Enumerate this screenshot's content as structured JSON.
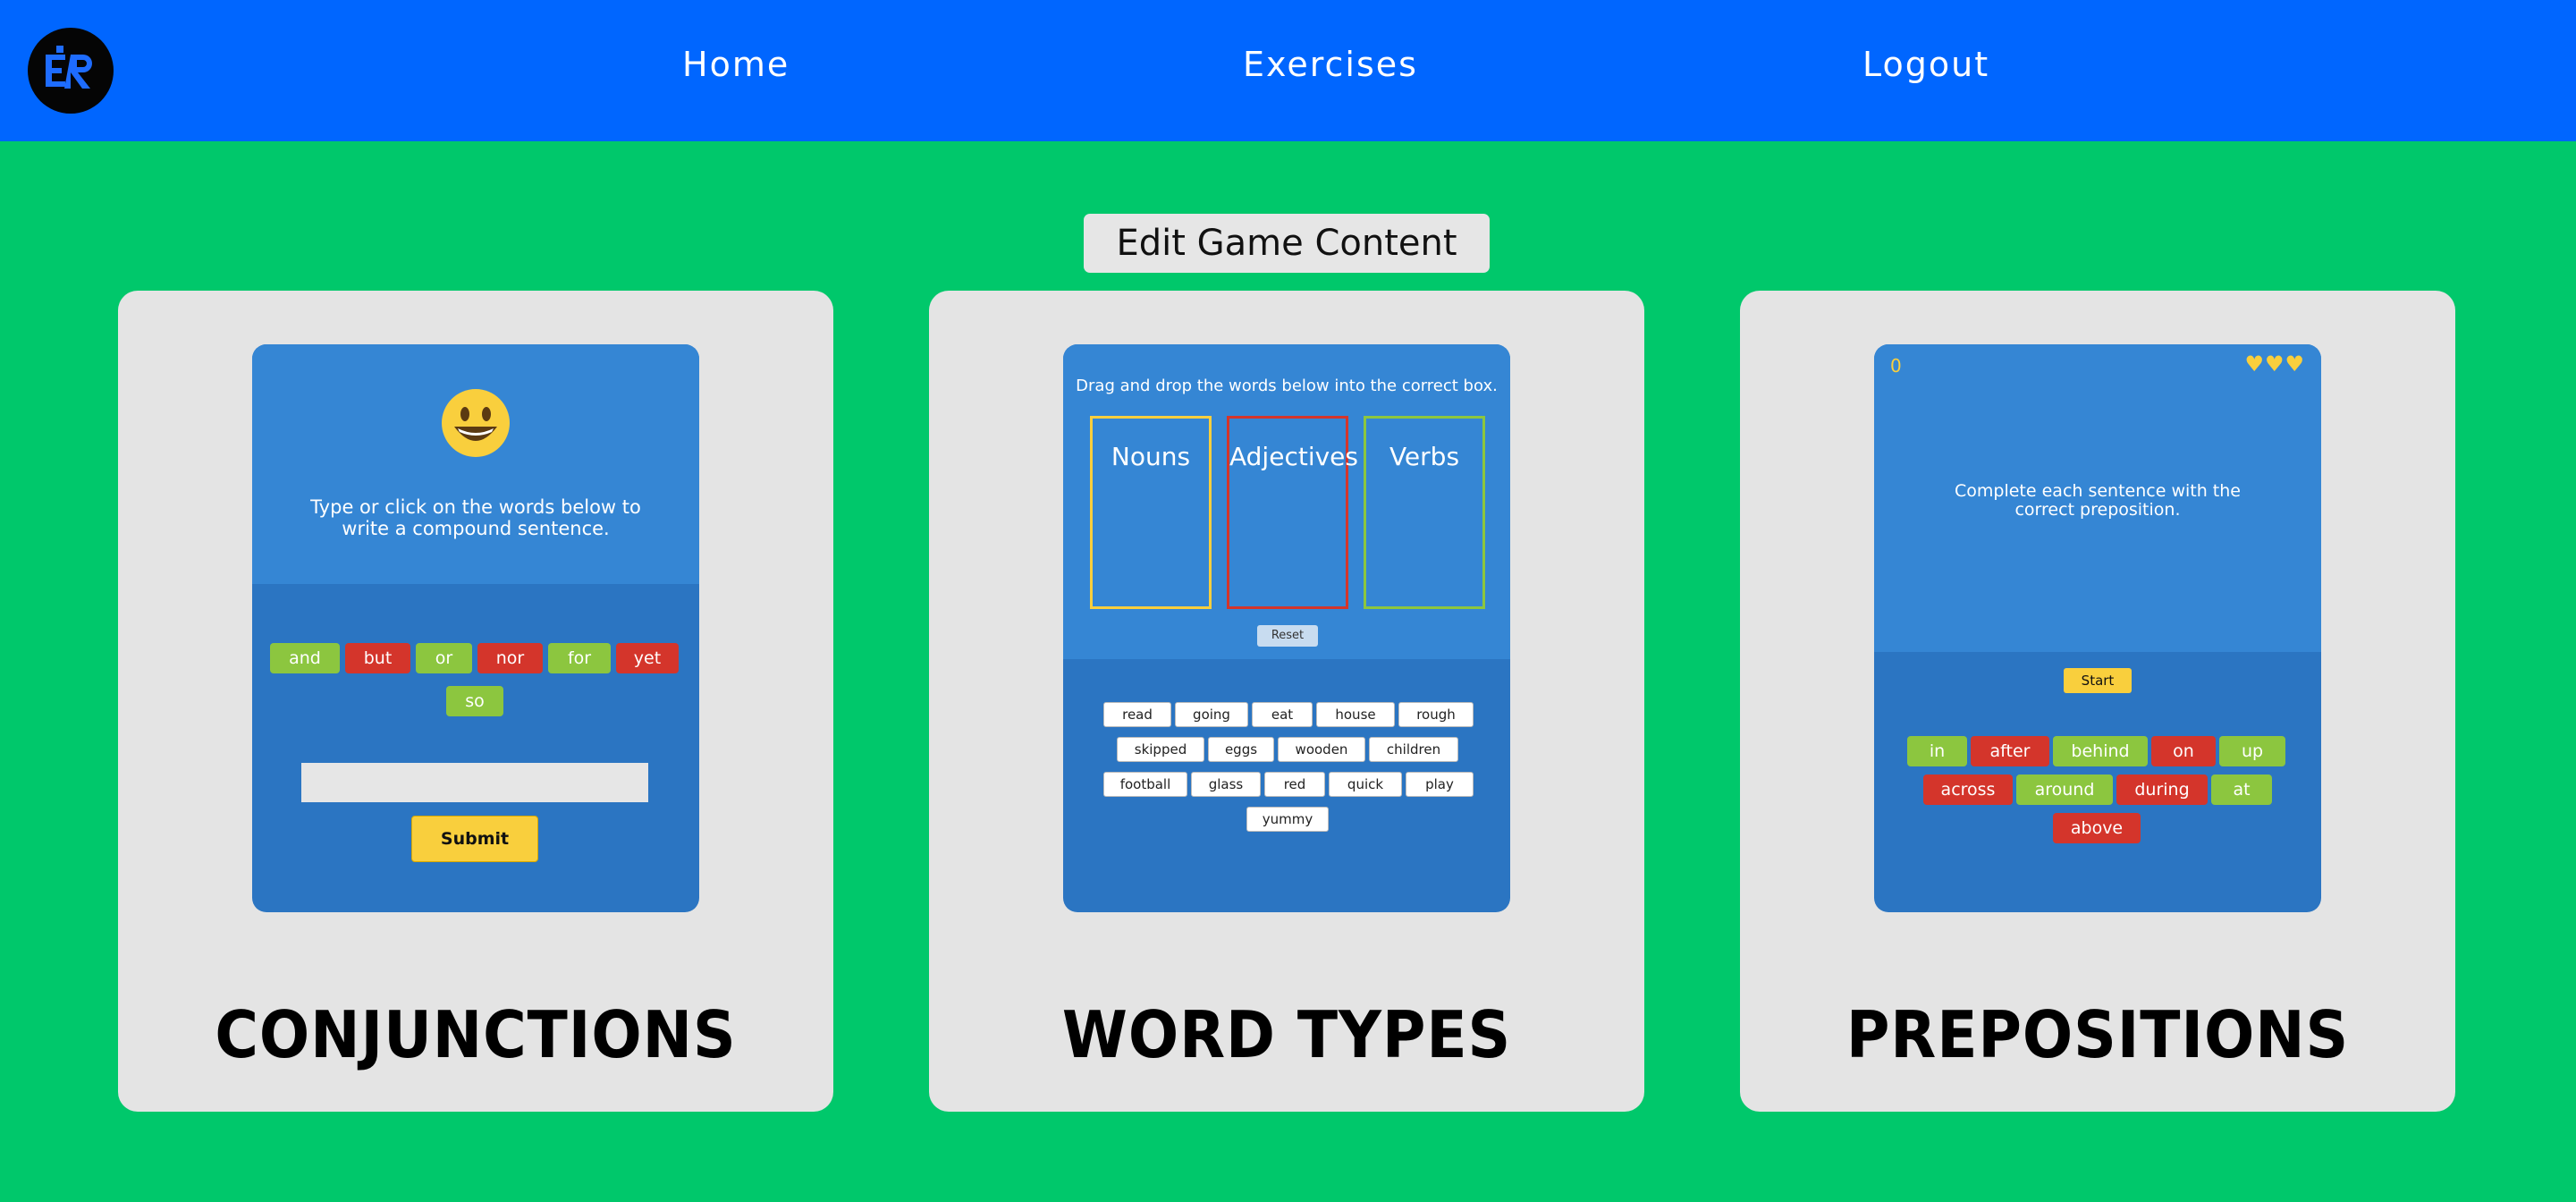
{
  "nav": {
    "logo_alt": "ER",
    "links": [
      "Home",
      "Exercises",
      "Logout"
    ]
  },
  "edit_button": "Edit Game Content",
  "colors": {
    "page": "#00c86b",
    "nav": "#0066ff",
    "card": "#e4e4e4",
    "green_chip": "#8cc63f",
    "red_chip": "#d4352b",
    "yellow": "#f9cf3d"
  },
  "cards": [
    {
      "title": "CONJUNCTIONS",
      "emoji": "😀",
      "instruction": "Type or click on the words below to write a compound sentence.",
      "words": [
        {
          "text": "and",
          "color": "green"
        },
        {
          "text": "but",
          "color": "red"
        },
        {
          "text": "or",
          "color": "green"
        },
        {
          "text": "nor",
          "color": "red"
        },
        {
          "text": "for",
          "color": "green"
        },
        {
          "text": "yet",
          "color": "red"
        },
        {
          "text": "so",
          "color": "green"
        }
      ],
      "input_value": "",
      "submit_label": "Submit"
    },
    {
      "title": "WORD TYPES",
      "instruction": "Drag and drop the words below into the correct box.",
      "boxes": [
        {
          "label": "Nouns",
          "border": "#f9cf3d"
        },
        {
          "label": "Adjectives",
          "border": "#d4352b"
        },
        {
          "label": "Verbs",
          "border": "#8cc63f"
        }
      ],
      "reset_label": "Reset",
      "words": [
        "read",
        "going",
        "eat",
        "house",
        "rough",
        "skipped",
        "eggs",
        "wooden",
        "children",
        "football",
        "glass",
        "red",
        "quick",
        "play",
        "yummy"
      ]
    },
    {
      "title": "PREPOSITIONS",
      "score": "0",
      "lives": "♥♥♥",
      "instruction": "Complete each sentence with the correct preposition.",
      "start_label": "Start",
      "words": [
        {
          "text": "in",
          "color": "green"
        },
        {
          "text": "after",
          "color": "red"
        },
        {
          "text": "behind",
          "color": "green"
        },
        {
          "text": "on",
          "color": "red"
        },
        {
          "text": "up",
          "color": "green"
        },
        {
          "text": "across",
          "color": "red"
        },
        {
          "text": "around",
          "color": "green"
        },
        {
          "text": "during",
          "color": "red"
        },
        {
          "text": "at",
          "color": "green"
        },
        {
          "text": "above",
          "color": "red"
        }
      ]
    }
  ]
}
